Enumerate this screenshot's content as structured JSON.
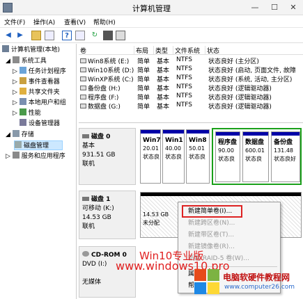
{
  "window": {
    "title": "计算机管理",
    "minimize": "—",
    "maximize": "☐"
  },
  "menu": [
    "文件(F)",
    "操作(A)",
    "查看(V)",
    "帮助(H)"
  ],
  "tree": {
    "root": "计算机管理(本地)",
    "system_tools": "系统工具",
    "task_scheduler": "任务计划程序",
    "event_viewer": "事件查看器",
    "shared_folders": "共享文件夹",
    "local_users": "本地用户和组",
    "performance": "性能",
    "device_manager": "设备管理器",
    "storage": "存储",
    "disk_management": "磁盘管理",
    "services": "服务和应用程序"
  },
  "volumes": {
    "headers": [
      "卷",
      "布局",
      "类型",
      "文件系统",
      "状态"
    ],
    "rows": [
      [
        "Win8系统 (E:)",
        "简单",
        "基本",
        "NTFS",
        "状态良好 (主分区)"
      ],
      [
        "Win10系统 (D:)",
        "简单",
        "基本",
        "NTFS",
        "状态良好 (启动, 页面文件, 故障"
      ],
      [
        "WinXP系统 (C:)",
        "简单",
        "基本",
        "NTFS",
        "状态良好 (系统, 活动, 主分区)"
      ],
      [
        "备份盘 (H:)",
        "简单",
        "基本",
        "NTFS",
        "状态良好 (逻辑驱动器)"
      ],
      [
        "程序盘 (F:)",
        "简单",
        "基本",
        "NTFS",
        "状态良好 (逻辑驱动器)"
      ],
      [
        "数据盘 (G:)",
        "简单",
        "基本",
        "NTFS",
        "状态良好 (逻辑驱动器)"
      ]
    ]
  },
  "disk0": {
    "name": "磁盘 0",
    "type": "基本",
    "size": "931.51 GB",
    "status": "联机",
    "partitions": [
      {
        "name": "Win7",
        "size": "20.01",
        "status": "状态良"
      },
      {
        "name": "Win1",
        "size": "40.00",
        "status": "状态良"
      },
      {
        "name": "Win8",
        "size": "50.01",
        "status": "状态良"
      },
      {
        "name": "程序盘",
        "size": "90.00",
        "status": "状态良"
      },
      {
        "name": "数据盘",
        "size": "600.01",
        "status": "状态良"
      },
      {
        "name": "备份盘",
        "size": "131.48",
        "status": "状态良好"
      }
    ]
  },
  "disk1": {
    "name": "磁盘 1",
    "type": "可移动 (K:)",
    "size": "14.53 GB",
    "status": "联机",
    "partition_size": "14.53 GB",
    "partition_status": "未分配"
  },
  "cdrom": {
    "name": "CD-ROM 0",
    "drive": "DVD (I:)",
    "status": "无媒体"
  },
  "context_menu": [
    {
      "label": "新建简单卷(I)...",
      "enabled": true
    },
    {
      "label": "新建跨区卷(N)...",
      "enabled": false
    },
    {
      "label": "新建带区卷(T)...",
      "enabled": false
    },
    {
      "label": "新建镜像卷(R)...",
      "enabled": false
    },
    {
      "label": "新建 RAID-5 卷(W)...",
      "enabled": false
    },
    {
      "label": "属",
      "enabled": true
    },
    {
      "label": "帮",
      "enabled": true
    }
  ],
  "watermark": {
    "line1": "Win10专业版",
    "line2": "www.windows10.pro"
  },
  "logo": {
    "name": "电脑软硬件教程网",
    "url": "www.computer26.com"
  },
  "colors": {
    "primary_bar": "#0000a8",
    "unallocated_bar": "#000000",
    "highlight_box": "#d22222",
    "selection_green": "#1aa01a"
  }
}
